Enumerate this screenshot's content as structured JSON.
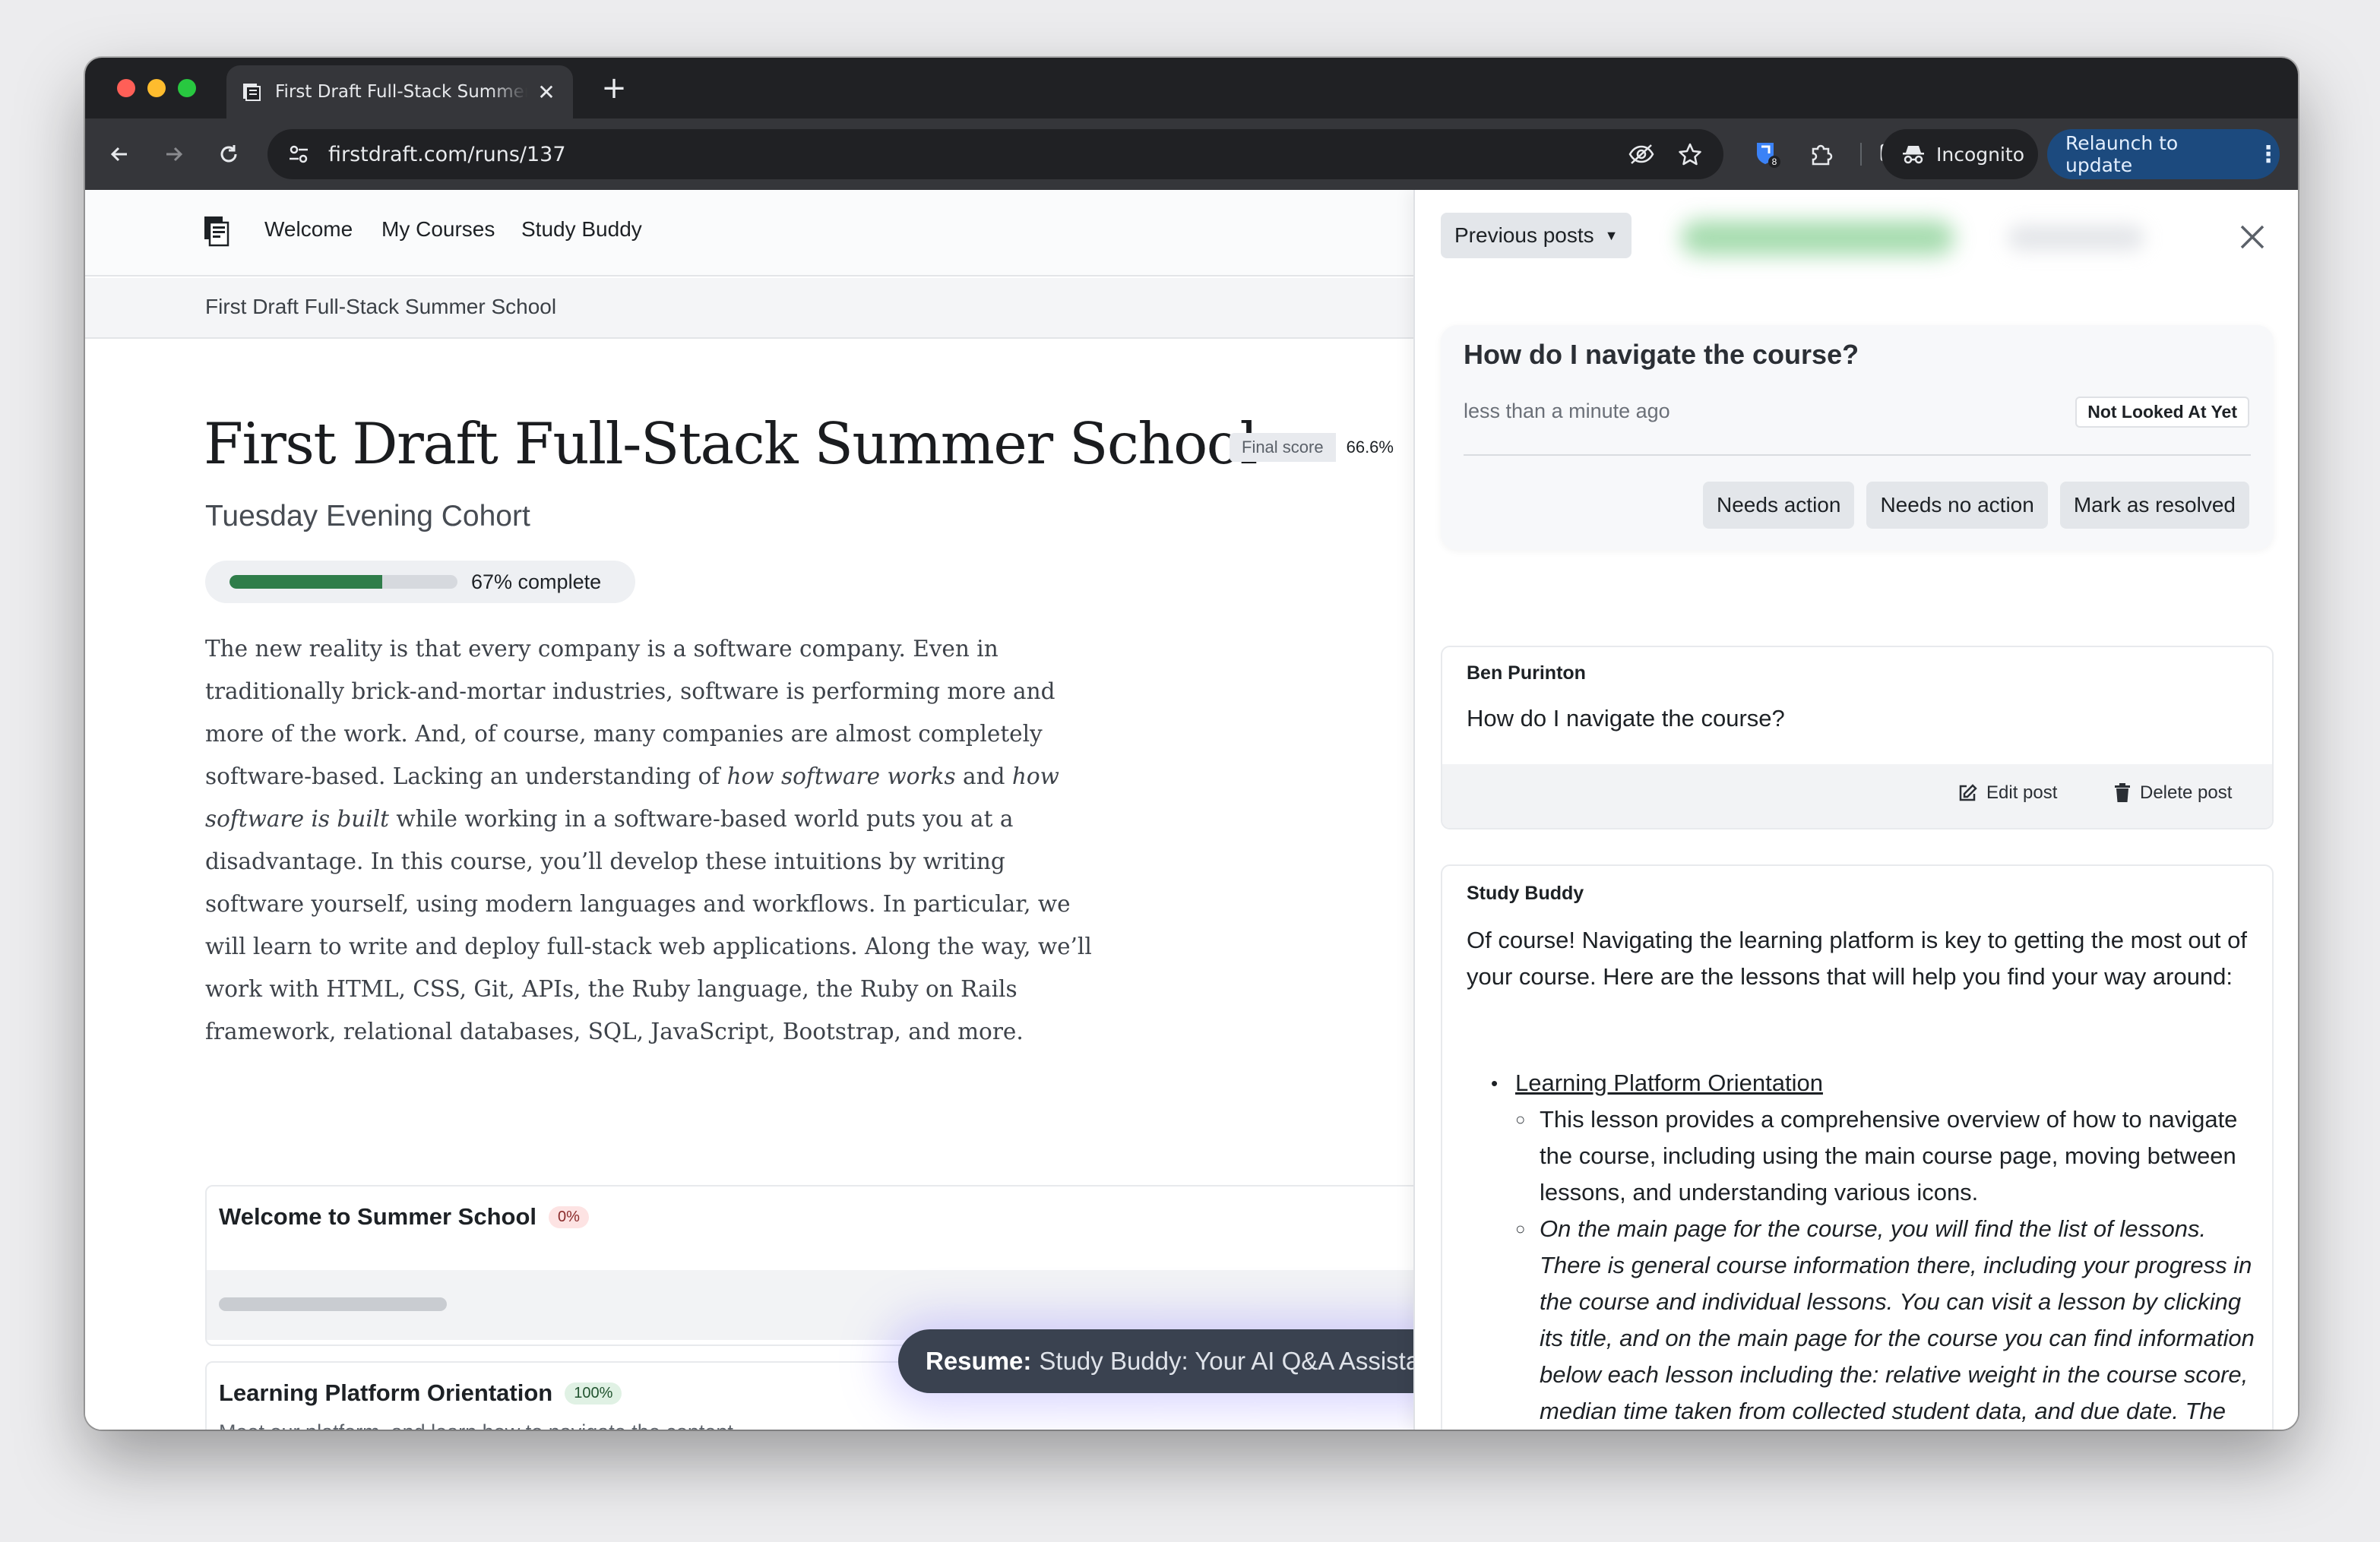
{
  "browser": {
    "tab_title": "First Draft Full-Stack Summer School",
    "url": "firstdraft.com/runs/137",
    "extension_badge": "8",
    "incognito_label": "Incognito",
    "relaunch_label": "Relaunch to update",
    "colors": {
      "frame": "#202124",
      "toolbar": "#35363a",
      "relaunch": "#1c4a7e"
    }
  },
  "site_nav": {
    "links": [
      "Welcome",
      "My Courses",
      "Study Buddy"
    ]
  },
  "breadcrumb": "First Draft Full-Stack Summer School",
  "course": {
    "title": "First Draft Full-Stack Summer School",
    "final_score_label": "Final score",
    "final_score_value": "66.6%",
    "cohort": "Tuesday Evening Cohort",
    "progress_fraction": 0.67,
    "progress_label": "67% complete",
    "description_parts": {
      "p1": "The new reality is that every company is a software company. Even in traditionally brick-and-mortar industries, software is performing more and more of the work. And, of course, many companies are almost completely software-based. Lacking an understanding of ",
      "em1": "how software works",
      "p2": " and ",
      "em2": "how software is built",
      "p3": " while working in a software-based world puts you at a disadvantage. In this course, you’ll develop these intuitions by writing software yourself, using modern languages and workflows. In particular, we will learn to write and deploy full-stack web applications. Along the way, we’ll work with HTML, CSS, Git, APIs, the Ruby language, the Ruby on Rails framework, relational databases, SQL, JavaScript, Bootstrap, and more."
    },
    "lessons": [
      {
        "title": "Welcome to Summer School",
        "percent": "0%"
      },
      {
        "title": "Learning Platform Orientation",
        "percent": "100%",
        "subtitle": "Meet our platform, and learn how to navigate the content."
      }
    ],
    "resume": {
      "prefix": "Resume:",
      "text": "Study Buddy: Your AI Q&A Assistant"
    }
  },
  "panel": {
    "previous_posts_label": "Previous posts",
    "question": {
      "title": "How do I navigate the course?",
      "time": "less than a minute ago",
      "status": "Not Looked At Yet",
      "actions": [
        "Needs action",
        "Needs no action",
        "Mark as resolved"
      ]
    },
    "user_post": {
      "author": "Ben Purinton",
      "body": "How do I navigate the course?",
      "edit_label": "Edit post",
      "delete_label": "Delete post"
    },
    "bot_reply": {
      "author": "Study Buddy",
      "intro": "Of course! Navigating the learning platform is key to getting the most out of your course. Here are the lessons that will help you find your way around:",
      "link": "Learning Platform Orientation",
      "sub1": "This lesson provides a comprehensive overview of how to navigate the course, including using the main course page, moving between lessons, and understanding various icons.",
      "sub2": "On the main page for the course, you will find the list of lessons. There is general course information there, including your progress in the course and individual lessons. You can visit a lesson by clicking its title, and on the main page for the course you can find information below each lesson including the: relative weight in the course score, median time taken from collected student data, and due date. The due dates are important to avoid late penalties and falling behind, please pay"
    }
  }
}
